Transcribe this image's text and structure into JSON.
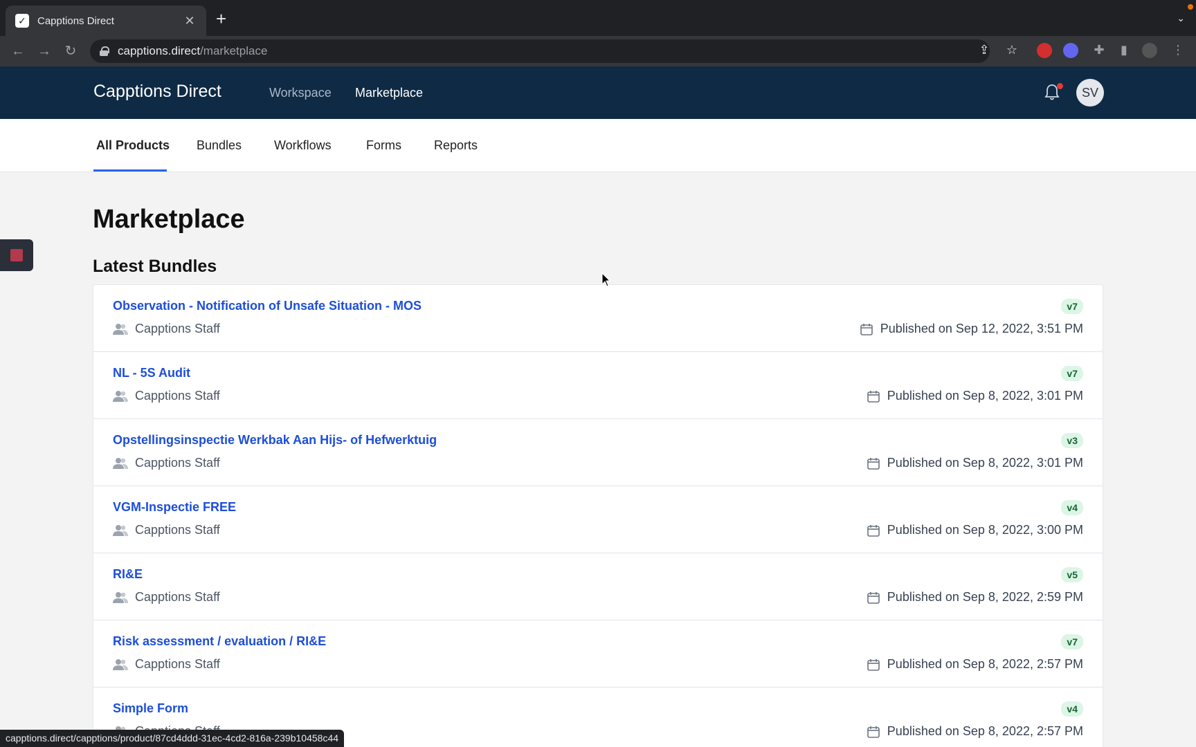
{
  "browser": {
    "tab_title": "Capptions Direct",
    "tab_close": "✕",
    "new_tab": "+",
    "url_host": "capptions.direct",
    "url_path": "/marketplace",
    "status_url": "capptions.direct/capptions/product/87cd4ddd-31ec-4cd2-816a-239b10458c44"
  },
  "header": {
    "brand": "Capptions Direct",
    "nav": [
      "Workspace",
      "Marketplace"
    ],
    "active_nav": "Marketplace",
    "avatar_initials": "SV"
  },
  "subnav": {
    "tabs": [
      "All Products",
      "Bundles",
      "Workflows",
      "Forms",
      "Reports"
    ],
    "active": "All Products"
  },
  "main": {
    "title": "Marketplace",
    "section_title": "Latest Bundles",
    "bundles": [
      {
        "title": "Observation - Notification of Unsafe Situation - MOS",
        "owner": "Capptions Staff",
        "version": "v7",
        "published": "Published on Sep 12, 2022, 3:51 PM"
      },
      {
        "title": "NL - 5S Audit",
        "owner": "Capptions Staff",
        "version": "v7",
        "published": "Published on Sep 8, 2022, 3:01 PM"
      },
      {
        "title": "Opstellingsinspectie Werkbak Aan Hijs- of Hefwerktuig",
        "owner": "Capptions Staff",
        "version": "v3",
        "published": "Published on Sep 8, 2022, 3:01 PM"
      },
      {
        "title": "VGM-Inspectie FREE",
        "owner": "Capptions Staff",
        "version": "v4",
        "published": "Published on Sep 8, 2022, 3:00 PM"
      },
      {
        "title": "RI&E",
        "owner": "Capptions Staff",
        "version": "v5",
        "published": "Published on Sep 8, 2022, 2:59 PM"
      },
      {
        "title": "Risk assessment / evaluation / RI&E",
        "owner": "Capptions Staff",
        "version": "v7",
        "published": "Published on Sep 8, 2022, 2:57 PM"
      },
      {
        "title": "Simple Form",
        "owner": "Capptions Staff",
        "version": "v4",
        "published": "Published on Sep 8, 2022, 2:57 PM"
      }
    ]
  },
  "colors": {
    "header_bg": "#0f2a44",
    "link": "#1d4ed8",
    "accent": "#2563eb",
    "badge_bg": "#dcf5e6"
  }
}
